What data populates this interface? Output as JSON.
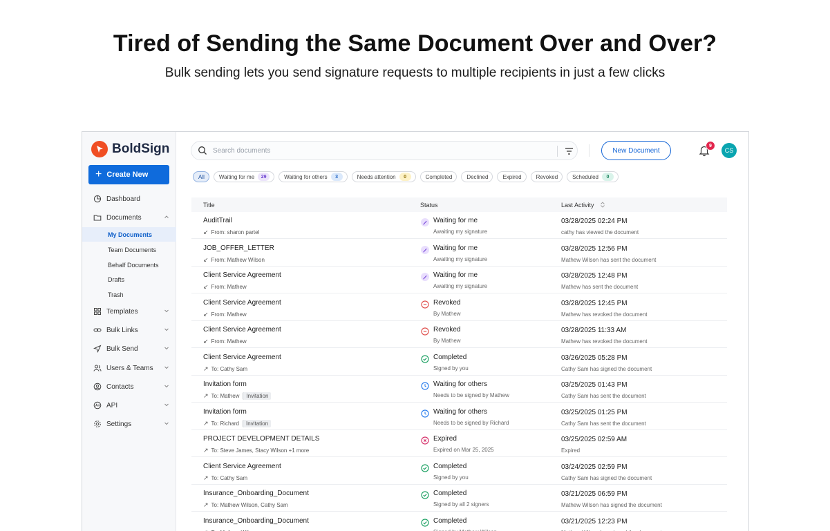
{
  "hero": {
    "title": "Tired of Sending the Same Document Over and Over?",
    "subtitle": "Bulk sending lets you send signature requests to multiple recipients in just a few clicks"
  },
  "brand": {
    "name": "BoldSign",
    "color": "#f04e23"
  },
  "sidebar": {
    "create_label": "Create New",
    "items": {
      "dashboard": "Dashboard",
      "documents": "Documents",
      "my_documents": "My Documents",
      "team_documents": "Team Documents",
      "behalf_documents": "Behalf Documents",
      "drafts": "Drafts",
      "trash": "Trash",
      "templates": "Templates",
      "bulk_links": "Bulk Links",
      "bulk_send": "Bulk Send",
      "users_teams": "Users & Teams",
      "contacts": "Contacts",
      "api": "API",
      "settings": "Settings"
    }
  },
  "header": {
    "search_placeholder": "Search documents",
    "new_document_label": "New Document",
    "notification_count": "9",
    "avatar_initials": "CS"
  },
  "filters": {
    "all": "All",
    "waiting_for_me": "Waiting for me",
    "waiting_for_me_count": "29",
    "waiting_for_others": "Waiting for others",
    "waiting_for_others_count": "3",
    "needs_attention": "Needs attention",
    "needs_attention_count": "0",
    "completed": "Completed",
    "declined": "Declined",
    "expired": "Expired",
    "revoked": "Revoked",
    "scheduled": "Scheduled",
    "scheduled_count": "0"
  },
  "table": {
    "headers": {
      "title": "Title",
      "status": "Status",
      "last_activity": "Last Activity"
    },
    "rows": [
      {
        "title": "AuditTrail",
        "dir": "↙",
        "party": "From: sharon partel",
        "tag": "",
        "status": "Waiting for me",
        "status_type": "waiting-me",
        "status_sub": "Awaiting my signature",
        "date": "03/28/2025 02:24 PM",
        "activity": "cathy has viewed the document"
      },
      {
        "title": "JOB_OFFER_LETTER",
        "dir": "↙",
        "party": "From: Mathew Wilson",
        "tag": "",
        "status": "Waiting for me",
        "status_type": "waiting-me",
        "status_sub": "Awaiting my signature",
        "date": "03/28/2025 12:56 PM",
        "activity": "Mathew Wilson has sent the document"
      },
      {
        "title": "Client Service Agreement",
        "dir": "↙",
        "party": "From: Mathew",
        "tag": "",
        "status": "Waiting for me",
        "status_type": "waiting-me",
        "status_sub": "Awaiting my signature",
        "date": "03/28/2025 12:48 PM",
        "activity": "Mathew has sent the document"
      },
      {
        "title": "Client Service Agreement",
        "dir": "↙",
        "party": "From: Mathew",
        "tag": "",
        "status": "Revoked",
        "status_type": "revoked",
        "status_sub": "By Mathew",
        "date": "03/28/2025 12:45 PM",
        "activity": "Mathew has revoked the document"
      },
      {
        "title": "Client Service Agreement",
        "dir": "↙",
        "party": "From: Mathew",
        "tag": "",
        "status": "Revoked",
        "status_type": "revoked",
        "status_sub": "By Mathew",
        "date": "03/28/2025 11:33 AM",
        "activity": "Mathew has revoked the document"
      },
      {
        "title": "Client Service Agreement",
        "dir": "↗",
        "party": "To: Cathy Sam",
        "tag": "",
        "status": "Completed",
        "status_type": "completed",
        "status_sub": "Signed by you",
        "date": "03/26/2025 05:28 PM",
        "activity": "Cathy Sam has signed the document"
      },
      {
        "title": "Invitation form",
        "dir": "↗",
        "party": "To: Mathew",
        "tag": "Invitation",
        "status": "Waiting for others",
        "status_type": "waiting-others",
        "status_sub": "Needs to be signed by Mathew",
        "date": "03/25/2025 01:43 PM",
        "activity": "Cathy Sam has sent the document"
      },
      {
        "title": "Invitation form",
        "dir": "↗",
        "party": "To: Richard",
        "tag": "Invitation",
        "status": "Waiting for others",
        "status_type": "waiting-others",
        "status_sub": "Needs to be signed by Richard",
        "date": "03/25/2025 01:25 PM",
        "activity": "Cathy Sam has sent the document"
      },
      {
        "title": "PROJECT DEVELOPMENT DETAILS",
        "dir": "↗",
        "party": "To: Steve James, Stacy Wilson +1 more",
        "tag": "",
        "status": "Expired",
        "status_type": "expired",
        "status_sub": "Expired on Mar 25, 2025",
        "date": "03/25/2025 02:59 AM",
        "activity": "Expired"
      },
      {
        "title": "Client Service Agreement",
        "dir": "↗",
        "party": "To: Cathy Sam",
        "tag": "",
        "status": "Completed",
        "status_type": "completed",
        "status_sub": "Signed by you",
        "date": "03/24/2025 02:59 PM",
        "activity": "Cathy Sam has signed the document"
      },
      {
        "title": "Insurance_Onboarding_Document",
        "dir": "↗",
        "party": "To: Mathew Wilson, Cathy Sam",
        "tag": "",
        "status": "Completed",
        "status_type": "completed",
        "status_sub": "Signed by all 2 signers",
        "date": "03/21/2025 06:59 PM",
        "activity": "Mathew Wilson has signed the document"
      },
      {
        "title": "Insurance_Onboarding_Document",
        "dir": "↗",
        "party": "To: Mathew Wilson",
        "tag": "",
        "status": "Completed",
        "status_type": "completed",
        "status_sub": "Signed by Mathew Wilson",
        "date": "03/21/2025 12:23 PM",
        "activity": "Mathew Wilson has signed the document"
      }
    ]
  },
  "colors": {
    "accent": "#0f6bdc",
    "waiting_me": "#7c4ddb",
    "revoked": "#e0524f",
    "completed": "#21a366",
    "waiting_others": "#2f80ed",
    "expired": "#d6336c"
  }
}
